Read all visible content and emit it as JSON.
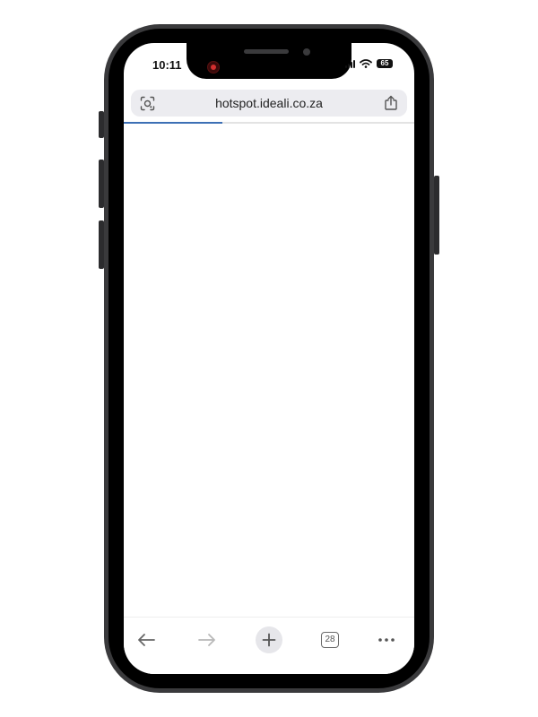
{
  "status_bar": {
    "time": "10:11",
    "battery": "65"
  },
  "address_bar": {
    "url": "hotspot.ideali.co.za"
  },
  "page_load": {
    "progress": 0.34
  },
  "toolbar": {
    "icons": [
      "back-arrow-icon",
      "forward-arrow-icon",
      "plus-icon",
      "tabs-icon",
      "more-icon"
    ],
    "tab_count": "28"
  },
  "colors": {
    "progress": "#3d6fb5",
    "frame": "#000000",
    "url_bar_bg": "#ececf0"
  }
}
